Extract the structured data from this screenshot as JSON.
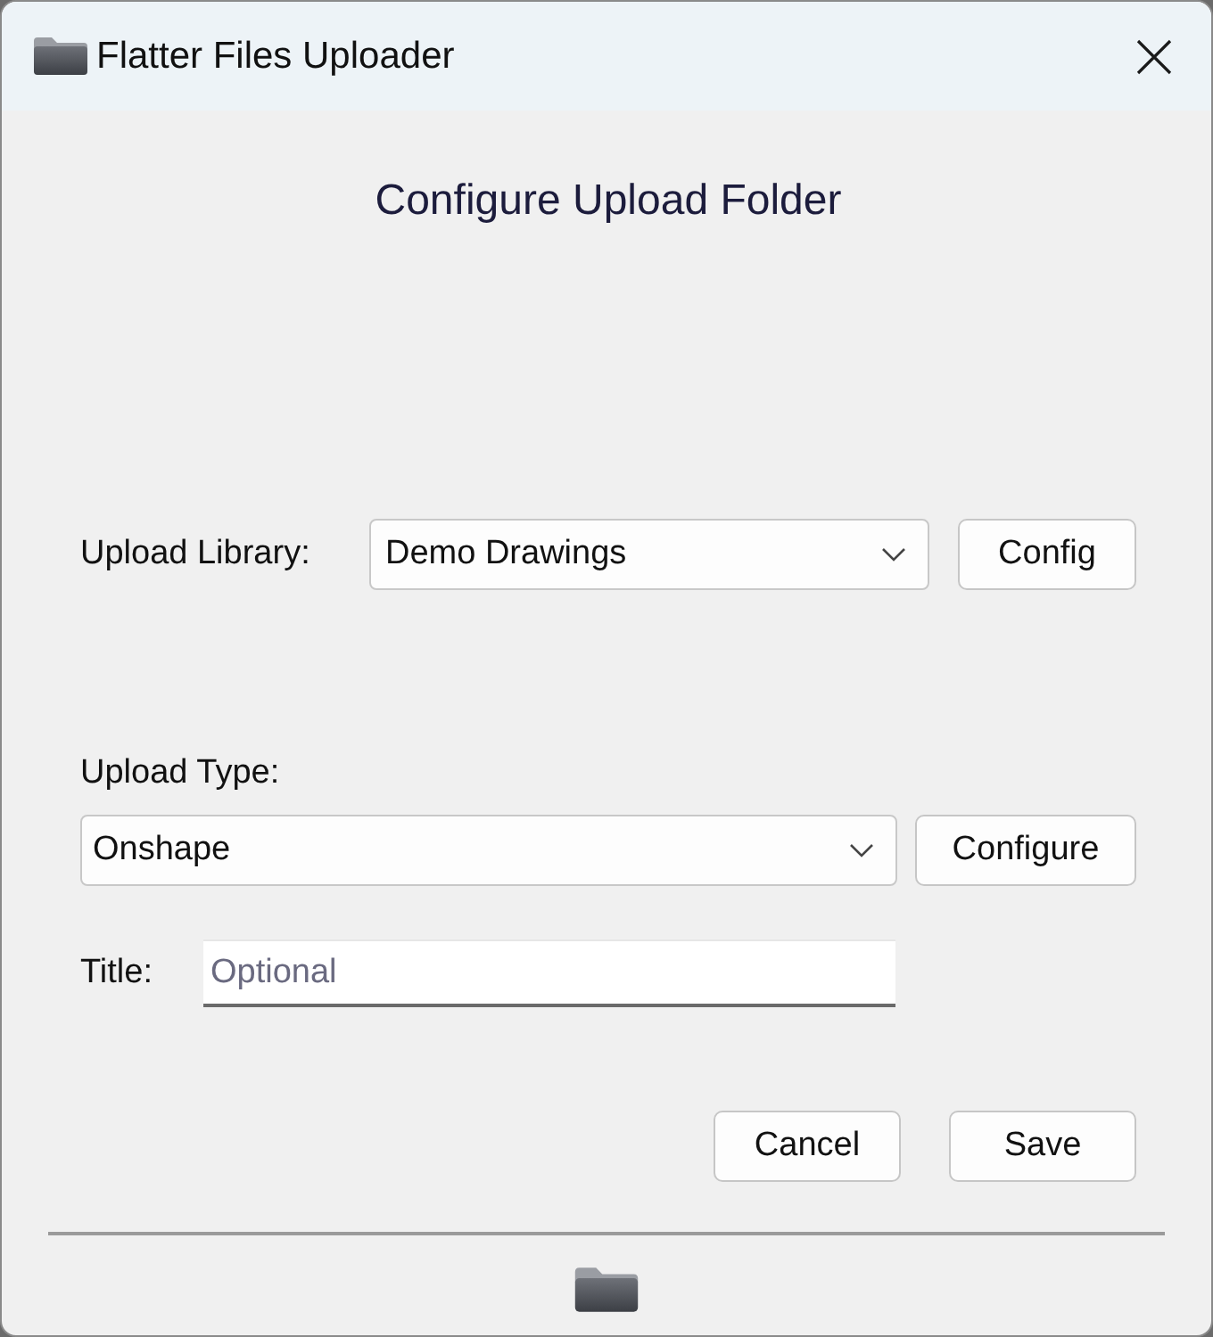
{
  "window": {
    "title": "Flatter Files Uploader"
  },
  "heading": "Configure Upload Folder",
  "library": {
    "label": "Upload Library:",
    "value": "Demo Drawings",
    "button": "Config"
  },
  "upload_type": {
    "label": "Upload Type:",
    "value": "Onshape",
    "button": "Configure"
  },
  "title_field": {
    "label": "Title:",
    "placeholder": "Optional"
  },
  "buttons": [
    "Cancel",
    "Save"
  ]
}
